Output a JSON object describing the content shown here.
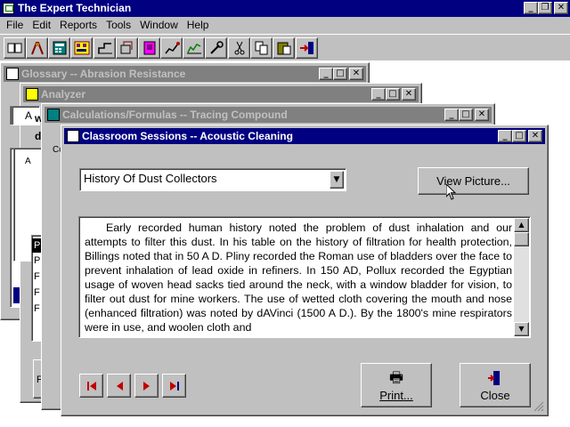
{
  "app": {
    "title": "The Expert Technician",
    "caption_buttons": [
      "_",
      "❐",
      "✕"
    ]
  },
  "menubar": {
    "items": [
      "File",
      "Edit",
      "Reports",
      "Tools",
      "Window",
      "Help"
    ]
  },
  "toolbar": {
    "buttons": [
      {
        "icon": "book-icon"
      },
      {
        "icon": "technician-icon"
      },
      {
        "icon": "calculator-icon"
      },
      {
        "icon": "analyzer-icon"
      },
      {
        "icon": "chart-icon"
      },
      {
        "icon": "tracing-icon"
      },
      {
        "icon": "classroom-icon"
      },
      {
        "icon": "graph-icon"
      },
      {
        "icon": "line-chart-icon"
      },
      {
        "icon": "tools-icon"
      },
      {
        "icon": "cut-icon"
      },
      {
        "icon": "copy-icon"
      },
      {
        "icon": "paste-icon"
      },
      {
        "icon": "exit-icon"
      }
    ]
  },
  "windows": {
    "glossary": {
      "title": "Glossary -- Abrasion Resistance"
    },
    "analyzer": {
      "title": "Analyzer"
    },
    "calc": {
      "title": "Calculations/Formulas -- Tracing Compound"
    },
    "classroom": {
      "title": "Classroom Sessions -- Acoustic Cleaning",
      "topic_value": "History Of Dust Collectors",
      "view_picture_label": "View Picture...",
      "text": "Early recorded human history noted the problem of dust inhalation and our attempts to filter this dust.  In his table on the history of filtration for health protection, Billings noted that in 50 A D. Pliny recorded the Roman use of bladders over the face to prevent inhalation of lead oxide in refiners. In 150 AD, Pollux recorded the Egyptian usage of woven head sacks tied around the neck, with a window bladder for vision, to filter out dust for mine workers.  The use of wetted cloth covering the mouth and nose (enhanced filtration) was noted by dAVinci (1500 A D.). By the 1800's mine respirators were in use, and woolen cloth and",
      "print_label": "Print...",
      "close_label": "Close"
    }
  },
  "fragments": {
    "analyzer_letters": [
      "A",
      "w",
      "d",
      "A"
    ],
    "calc_letters": [
      "Co"
    ],
    "list_letters": [
      "P",
      "P",
      "F",
      "F",
      "F"
    ],
    "calc_bottom": "F"
  },
  "colors": {
    "active_title": "#000080",
    "inactive_title": "#808080",
    "face": "#c0c0c0",
    "nav_arrow": "#c00000"
  }
}
